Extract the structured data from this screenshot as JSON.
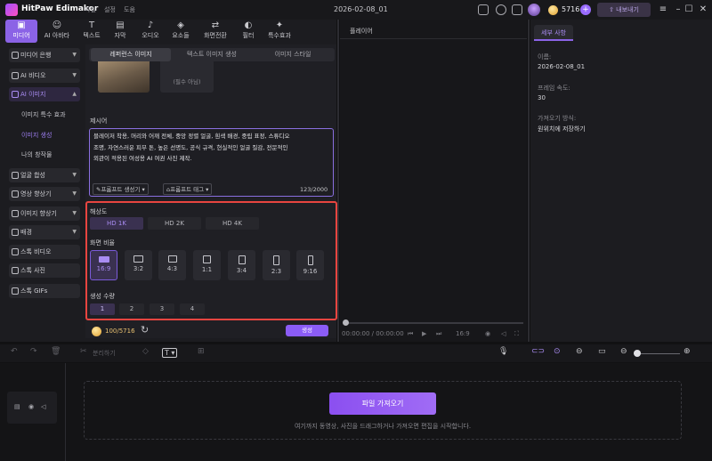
{
  "app": {
    "name": "HitPaw Edimakor",
    "project_name": "2026-02-08_01"
  },
  "menu": [
    "파일",
    "설정",
    "도움"
  ],
  "header": {
    "credits": "5716",
    "export_label": "내보내기"
  },
  "toolbar": [
    {
      "label": "미디어",
      "icon": "media-icon"
    },
    {
      "label": "AI 아바타",
      "icon": "ai-avatar-icon"
    },
    {
      "label": "텍스트",
      "icon": "text-icon"
    },
    {
      "label": "자막",
      "icon": "subtitle-icon"
    },
    {
      "label": "오디오",
      "icon": "audio-icon"
    },
    {
      "label": "요소들",
      "icon": "elements-icon"
    },
    {
      "label": "화면전환",
      "icon": "transition-icon"
    },
    {
      "label": "필터",
      "icon": "filter-icon"
    },
    {
      "label": "특수효과",
      "icon": "effects-icon"
    }
  ],
  "sidebar": {
    "items": [
      {
        "label": "미디어 은행"
      },
      {
        "label": "AI 비디오"
      },
      {
        "label": "AI 이미지"
      },
      {
        "label": "얼굴 합성"
      },
      {
        "label": "영상 향상기"
      },
      {
        "label": "이미지 향상기"
      },
      {
        "label": "배경"
      },
      {
        "label": "스톡 비디오"
      },
      {
        "label": "스톡 사진"
      },
      {
        "label": "스톡 GIFs"
      }
    ],
    "subitems": [
      "이미지 특수 효과",
      "이미지 생성",
      "나의 창작물"
    ]
  },
  "generator": {
    "tabs": [
      "레퍼런스 이미지",
      "텍스트 이미지 생성",
      "이미지 스타일"
    ],
    "optional_label": "(필수 아님)",
    "prompt_label": "제시어",
    "prompt_lines": [
      "블레이저 착용, 머리와 어깨 전체, 중앙 정렬 얼굴, 흰색 배경, 중립 표정, 스튜디오",
      "조명, 자연스러운 피부 톤, 높은 선명도, 공식 규격, 현실적인 얼굴 질감, 전문적인",
      "외관이 적용된 여성용 AI 여권 사진 제작."
    ],
    "prompt_generator": "프롬프트 생성기",
    "prompt_tag": "프롬프트 태그",
    "char_count": "123/2000",
    "resolution_label": "해상도",
    "resolutions": [
      "HD 1K",
      "HD 2K",
      "HD 4K"
    ],
    "aspect_label": "화면 비율",
    "aspects": [
      "16:9",
      "3:2",
      "4:3",
      "1:1",
      "3:4",
      "2:3",
      "9:16"
    ],
    "count_label": "생성 수량",
    "counts": [
      "1",
      "2",
      "3",
      "4"
    ],
    "cost": "100/5716",
    "generate_label": "생성"
  },
  "player": {
    "title": "플레이어",
    "time": "00:00:00 / 00:00:00",
    "aspect": "16:9"
  },
  "details": {
    "tab": "세부 사항",
    "name_label": "이름:",
    "name_value": "2026-02-08_01",
    "fps_label": "프레임 속도:",
    "fps_value": "30",
    "import_label": "가져오기 방식:",
    "import_value": "원위치에 저장하기"
  },
  "timeline": {
    "split_label": "분리하기",
    "import_button": "파일 가져오기",
    "hint": "여기까지 동영상, 사진을 드래그하거나 가져오면 편집을 시작합니다."
  }
}
